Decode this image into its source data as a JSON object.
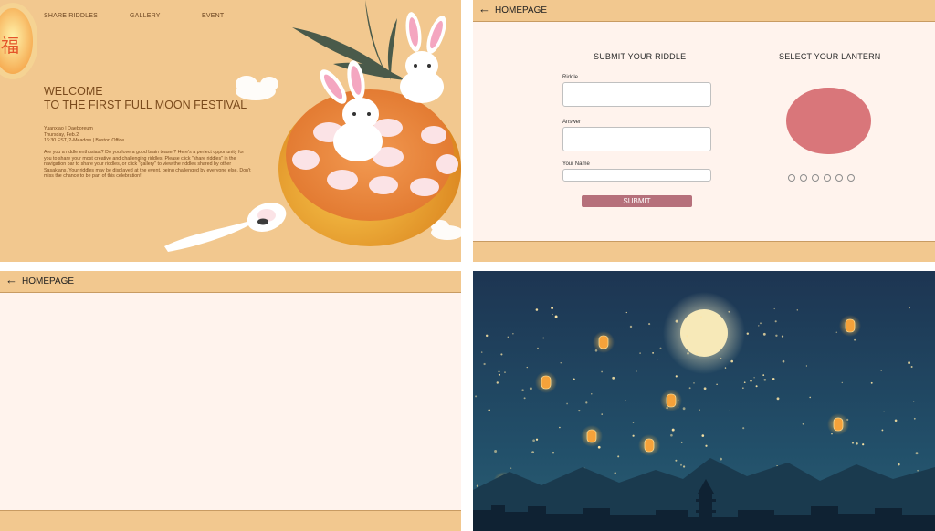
{
  "panel1": {
    "nav": [
      "SHARE RIDDLES",
      "GALLERY",
      "EVENT"
    ],
    "lantern_char": "福",
    "welcome_line1": "WELCOME",
    "welcome_line2": "TO THE FIRST FULL MOON FESTIVAL",
    "meta": [
      "Yuanxiao | Daeboreum",
      "Thursday, Feb.2",
      "16:30 EST, 2-Meadow | Boston Office"
    ],
    "intro": "Are you a riddle enthusiast? Do you love a good brain teaser? Here's a perfect opportunity for you to share your most creative and challenging riddles! Please click \"share riddles\" in the navigation bar to share your riddles, or click \"gallery\" to view the riddles shared by other Sasakians. Your riddles may be displayed at the event, being challenged by everyone else. Don't miss the chance to be part of this celebration!"
  },
  "panel2": {
    "back_icon": "←",
    "home_label": "HOMEPAGE",
    "submit_title": "SUBMIT YOUR RIDDLE",
    "lantern_title": "SELECT YOUR LANTERN",
    "fields": {
      "riddle": "Riddle",
      "answer": "Answer",
      "name": "Your Name"
    },
    "submit_label": "SUBMIT",
    "lantern_color": "#d9767a"
  },
  "panel3": {
    "back_icon": "←",
    "home_label": "HOMEPAGE"
  },
  "colors": {
    "header": "#f2c88f",
    "page": "#fff3ed",
    "accent": "#b6707b",
    "night": "#1d3552",
    "moon": "#f7e9b8"
  }
}
